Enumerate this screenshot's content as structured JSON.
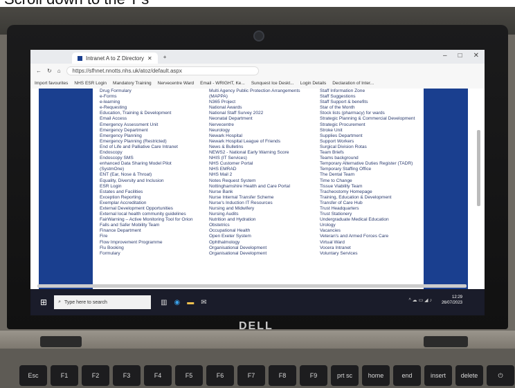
{
  "caption": "Scroll down to the T's",
  "brand": "DELL",
  "browser": {
    "tab_title": "Intranet A to Z Directory",
    "url": "https://sfhnet.nnotts.nhs.uk/atoz/default.aspx",
    "favorites": [
      "Import favourites",
      "NHS ESR Login",
      "Mandatory Training",
      "Nervecentre Ward",
      "Email - WRIGHT, Ke...",
      "Sunquest Ice Deskt...",
      "Login Details",
      "Declaration of Inter..."
    ]
  },
  "col1": [
    "Drug Formulary",
    "e-Forms",
    "e-learning",
    "e-Requesting",
    "Education, Training & Development",
    "Email Access",
    "Emergency Assessment Unit",
    "Emergency Department",
    "Emergency Planning",
    "Emergency Planning (Restricted)",
    "End of Life and Palliative Care Intranet",
    "Endoscopy",
    "Endoscopy SMS",
    "enhanced Data Sharing Model Pilot",
    "(SystmOne)",
    "ENT (Ear, Nose & Throat)",
    "Equality, Diversity and Inclusion",
    "ESR Login",
    "Estates and Facilities",
    "Exception Reporting",
    "Exemplar Accreditation",
    "External Development Opportunities",
    "External local health community guidelines",
    "FairWarning – Active Monitoring Tool for Orion",
    "Falls and Safer Mobility Team",
    "Finance Department",
    "Fire",
    "Flow Improvement Programme",
    "Flu Booking",
    "Formulary"
  ],
  "col2": [
    "Multi Agency Public Protection Arrangements",
    "(MAPPA)",
    "N365 Project",
    "National Awards",
    "National Staff Survey 2022",
    "Neonatal Department",
    "Nervecentre",
    "Neurology",
    "Newark Hospital",
    "Newark Hospital League of Friends",
    "News & Bulletins",
    "NEWS2 - National Early Warning Score",
    "NHIS (IT Services)",
    "NHS Customer Portal",
    "NHS EMRAD",
    "NHS Mail 2",
    "Notes Request System",
    "Nottinghamshire Health and Care Portal",
    "Nurse Bank",
    "Nurse Internal Transfer Scheme",
    "Nurse's Induction IT Resources",
    "Nursing and Midwifery",
    "Nursing Audits",
    "Nutrition and Hydration",
    "Obstetrics",
    "Occupational Health",
    "Open Exeter System",
    "Ophthalmology",
    "Organisational Development",
    "Organisational Development"
  ],
  "col3": [
    "Staff Information Zone",
    "Staff Suggestions",
    "Staff Support & benefits",
    "Star of the Month",
    "Stock lists (pharmacy) for wards",
    "Strategic Planning & Commercial Development",
    "Strategic Procurement",
    "Stroke Unit",
    "Supplies Department",
    "Support Workers",
    "Surgical Division Rotas",
    "Team Briefs",
    "Teams background",
    "Temporary Alternative Duties Register (TADR)",
    "Temporary Staffing Office",
    "The Dental Team",
    "Time to Change",
    "Tissue Viability Team",
    "Tracheostomy Homepage",
    "Training, Education & Development",
    "Transfer of Care Hub",
    "Trust Headquarters",
    "Trust Stationery",
    "Undergraduate Medical Education",
    "Urology",
    "Vacancies",
    "Veteran's and Armed Forces Care",
    "Virtual Ward",
    "Vocera Intranet",
    "Voluntary Services"
  ],
  "taskbar": {
    "search_placeholder": "Type here to search",
    "time": "12:29",
    "date": "26/07/2023"
  },
  "keys": [
    "Esc",
    "F1",
    "F2",
    "F3",
    "F4",
    "F5",
    "F6",
    "F7",
    "F8",
    "F9",
    "prt sc",
    "home",
    "end",
    "insert",
    "delete",
    "⏻"
  ]
}
